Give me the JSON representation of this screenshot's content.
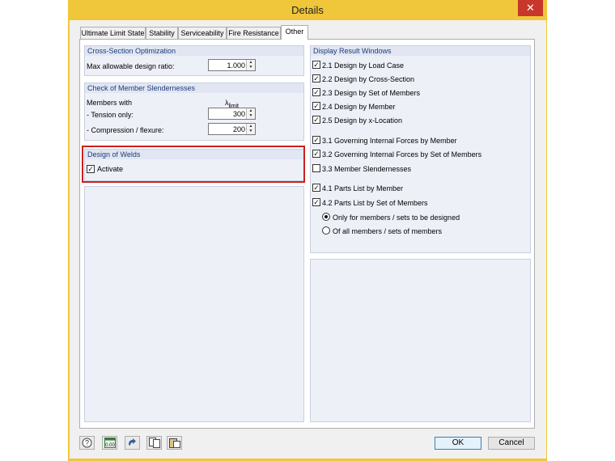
{
  "window": {
    "title": "Details",
    "close_glyph": "✕"
  },
  "tabs": [
    {
      "label": "Ultimate Limit State"
    },
    {
      "label": "Stability"
    },
    {
      "label": "Serviceability"
    },
    {
      "label": "Fire Resistance"
    },
    {
      "label": "Other"
    }
  ],
  "cross_section": {
    "header": "Cross-Section Optimization",
    "max_ratio_label": "Max allowable design ratio:",
    "max_ratio_value": "1.000"
  },
  "slenderness": {
    "header": "Check of Member Slendernesses",
    "members_with_label": "Members with",
    "lambda_symbol": "λ",
    "lambda_sub": "limit",
    "tension_label": "- Tension only:",
    "tension_value": "300",
    "compression_label": "- Compression / flexure:",
    "compression_value": "200"
  },
  "welds": {
    "header": "Design of Welds",
    "activate_label": "Activate",
    "activate_checked": true
  },
  "result_windows": {
    "header": "Display Result Windows",
    "items": [
      {
        "label": "2.1 Design by Load Case",
        "checked": true
      },
      {
        "label": "2.2 Design by Cross-Section",
        "checked": true
      },
      {
        "label": "2.3 Design by Set of Members",
        "checked": true
      },
      {
        "label": "2.4 Design by Member",
        "checked": true
      },
      {
        "label": "2.5 Design by x-Location",
        "checked": true
      },
      {
        "label": "3.1 Governing Internal Forces by Member",
        "checked": true
      },
      {
        "label": "3.2 Governing Internal Forces by Set of Members",
        "checked": true
      },
      {
        "label": "3.3 Member Slendernesses",
        "checked": false
      },
      {
        "label": "4.1 Parts List by Member",
        "checked": true
      },
      {
        "label": "4.2 Parts List by Set of Members",
        "checked": true
      }
    ],
    "radios": [
      {
        "label": "Only for members / sets to be designed",
        "selected": true
      },
      {
        "label": "Of all members / sets of members",
        "selected": false
      }
    ]
  },
  "footer": {
    "icons": [
      "help-icon",
      "units-icon",
      "reset-icon",
      "copy-icon",
      "paste-icon"
    ],
    "units_text": "0.00",
    "ok_label": "OK",
    "cancel_label": "Cancel"
  },
  "colors": {
    "window_frame": "#f0c63a",
    "close_button": "#c7372b",
    "group_header_text": "#1c3c7a",
    "highlight": "#cc1f1f"
  }
}
